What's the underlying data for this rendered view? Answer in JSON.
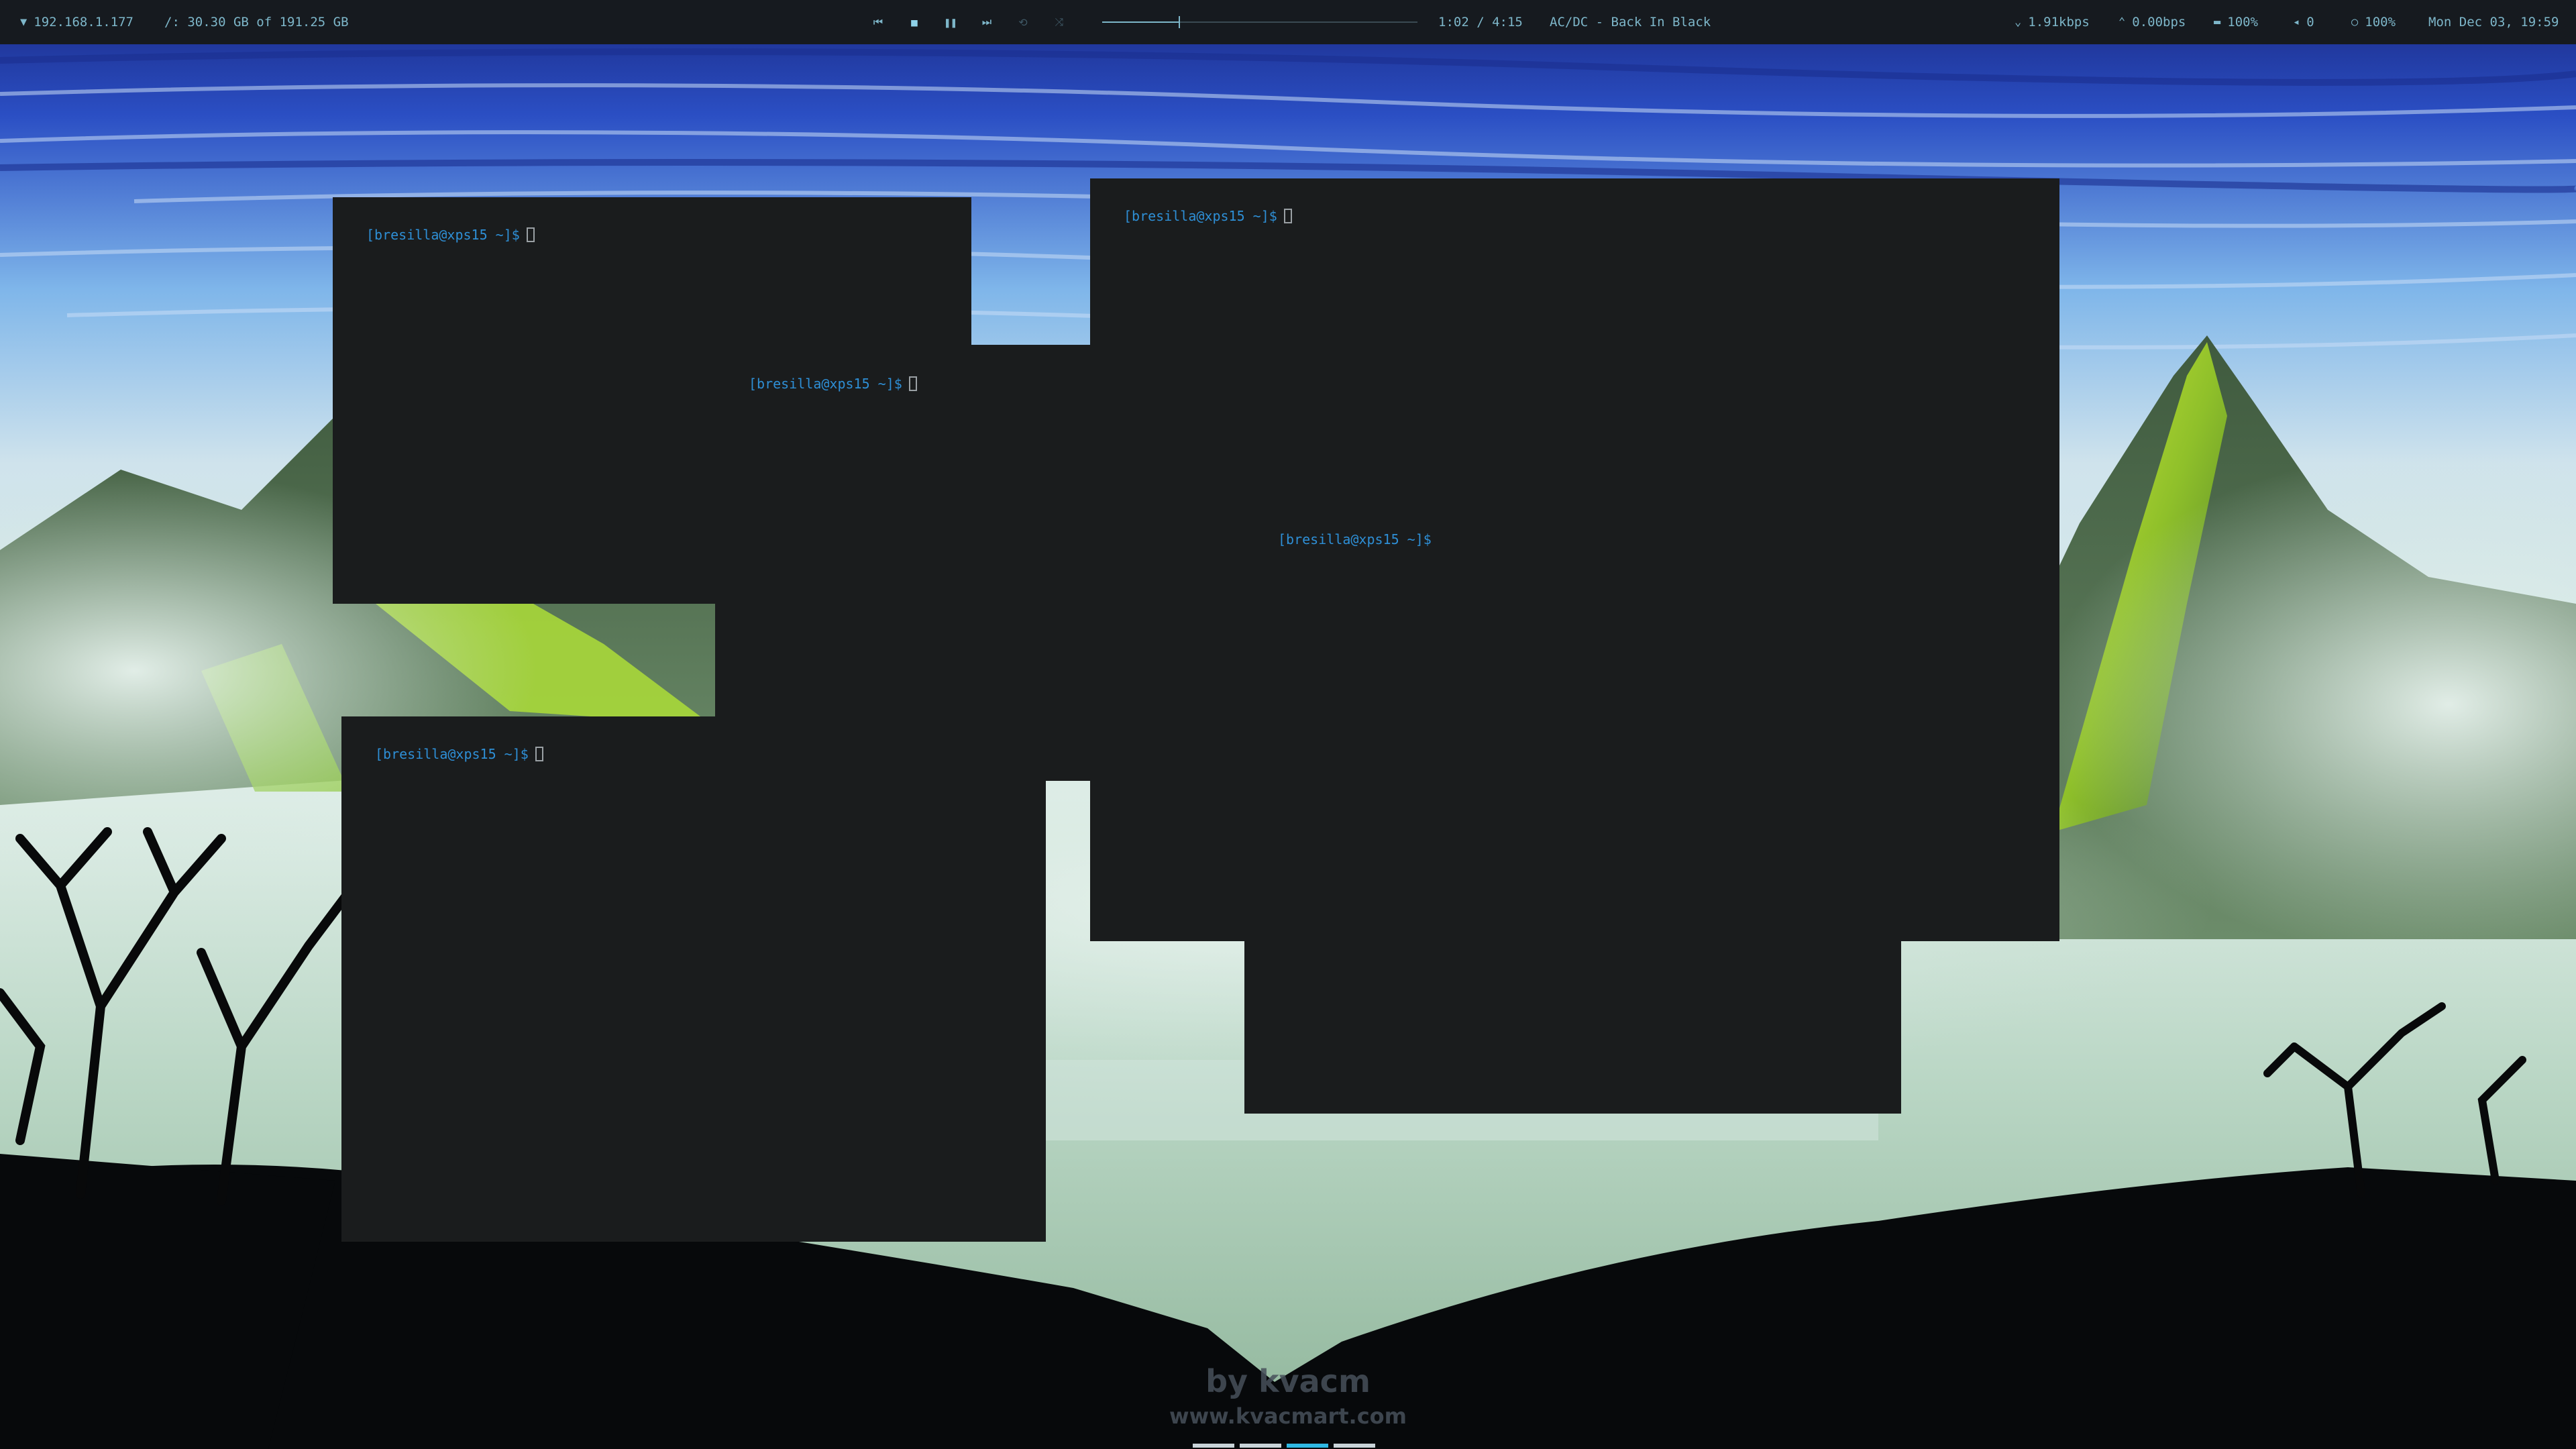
{
  "topbar": {
    "ip": "192.168.1.177",
    "disk": "/: 30.30 GB of 191.25 GB",
    "media": {
      "time": "1:02 / 4:15",
      "track": "AC/DC - Back In Black",
      "progress": 0.243,
      "icons": [
        "previous-icon",
        "stop-icon",
        "pause-icon",
        "next-icon",
        "repeat-icon",
        "shuffle-icon"
      ]
    },
    "net_down": "1.91kbps",
    "net_up": "0.00bps",
    "battery": "100%",
    "volume": "0",
    "brightness": "100%",
    "clock": "Mon Dec 03, 19:59"
  },
  "terminals": [
    {
      "id": "terminal-1",
      "prompt": "[bresilla@xps15 ~]$",
      "cursor": true
    },
    {
      "id": "terminal-2",
      "prompt": "[bresilla@xps15 ~]$",
      "cursor": true
    },
    {
      "id": "terminal-3",
      "prompt": "[bresilla@xps15 ~]$",
      "cursor": true
    },
    {
      "id": "terminal-4",
      "prompt": "[bresilla@xps15 ~]$",
      "cursor": false
    },
    {
      "id": "terminal-5",
      "prompt": "[bresilla@xps15 ~]$",
      "cursor": true
    }
  ],
  "watermark": {
    "by": "by kvacm",
    "url": "www.kvacmart.com"
  },
  "colors": {
    "bar_bg": "#161a1f",
    "bar_fg": "#7db6c9",
    "terminal_bg": "#1a1c1d",
    "prompt": "#2e8fd6"
  }
}
